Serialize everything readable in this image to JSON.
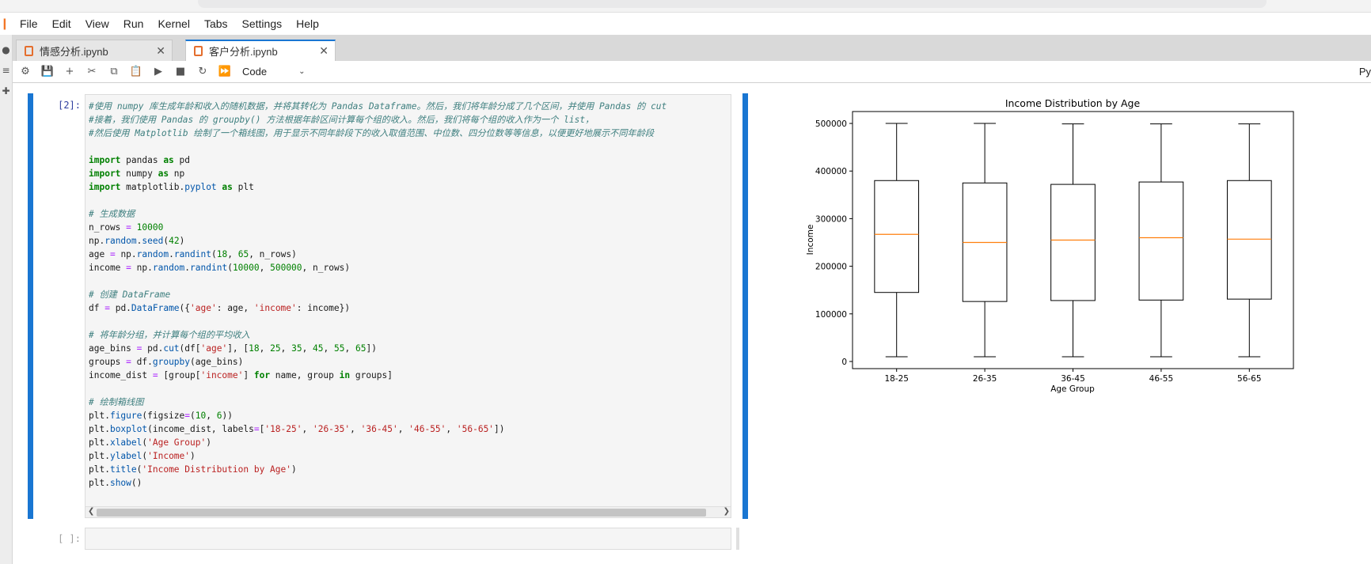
{
  "menubar": {
    "items": [
      "File",
      "Edit",
      "View",
      "Run",
      "Kernel",
      "Tabs",
      "Settings",
      "Help"
    ]
  },
  "tabs": [
    {
      "label": "情感分析.ipynb",
      "active": false
    },
    {
      "label": "客户分析.ipynb",
      "active": true
    }
  ],
  "toolbar": {
    "icons": [
      "bug-icon",
      "save-icon",
      "add-cell-icon",
      "cut-icon",
      "copy-icon",
      "paste-icon",
      "run-icon",
      "stop-icon",
      "restart-icon",
      "fast-forward-icon"
    ],
    "cell_type": "Code",
    "kernel_name": "Py"
  },
  "cells": [
    {
      "prompt": "[2]:",
      "code_lines": [
        "#使用 numpy 库生成年龄和收入的随机数据，并将其转化为 Pandas Dataframe。然后，我们将年龄分成了几个区间，并使用 Pandas 的 cut",
        "#接着，我们使用 Pandas 的 groupby() 方法根据年龄区间计算每个组的收入。然后，我们将每个组的收入作为一个 list，",
        "#然后使用 Matplotlib 绘制了一个箱线图，用于显示不同年龄段下的收入取值范围、中位数、四分位数等等信息，以便更好地展示不同年龄段",
        "",
        "import pandas as pd",
        "import numpy as np",
        "import matplotlib.pyplot as plt",
        "",
        "# 生成数据",
        "n_rows = 10000",
        "np.random.seed(42)",
        "age = np.random.randint(18, 65, n_rows)",
        "income = np.random.randint(10000, 500000, n_rows)",
        "",
        "# 创建 DataFrame",
        "df = pd.DataFrame({'age': age, 'income': income})",
        "",
        "# 将年龄分组，并计算每个组的平均收入",
        "age_bins = pd.cut(df['age'], [18, 25, 35, 45, 55, 65])",
        "groups = df.groupby(age_bins)",
        "income_dist = [group['income'] for name, group in groups]",
        "",
        "# 绘制箱线图",
        "plt.figure(figsize=(10, 6))",
        "plt.boxplot(income_dist, labels=['18-25', '26-35', '36-45', '46-55', '56-65'])",
        "plt.xlabel('Age Group')",
        "plt.ylabel('Income')",
        "plt.title('Income Distribution by Age')",
        "plt.show()"
      ]
    },
    {
      "prompt": "[ ]:",
      "code_lines": []
    }
  ],
  "chart_data": {
    "type": "boxplot",
    "title": "Income Distribution by Age",
    "xlabel": "Age Group",
    "ylabel": "Income",
    "categories": [
      "18-25",
      "26-35",
      "36-45",
      "46-55",
      "56-65"
    ],
    "boxes": [
      {
        "min": 10000,
        "q1": 145000,
        "median": 267000,
        "q3": 380000,
        "max": 500000
      },
      {
        "min": 10000,
        "q1": 126000,
        "median": 250000,
        "q3": 375000,
        "max": 500000
      },
      {
        "min": 10000,
        "q1": 128000,
        "median": 255000,
        "q3": 372000,
        "max": 499000
      },
      {
        "min": 10000,
        "q1": 129000,
        "median": 260000,
        "q3": 377000,
        "max": 499000
      },
      {
        "min": 10000,
        "q1": 131000,
        "median": 257000,
        "q3": 380000,
        "max": 499000
      }
    ],
    "ylim": [
      -15000,
      525000
    ],
    "yticks": [
      0,
      100000,
      200000,
      300000,
      400000,
      500000
    ],
    "median_color": "#ff7f0e",
    "box_color": "#000000"
  },
  "colors": {
    "accent": "#1976d2",
    "logo": "#f37626"
  }
}
